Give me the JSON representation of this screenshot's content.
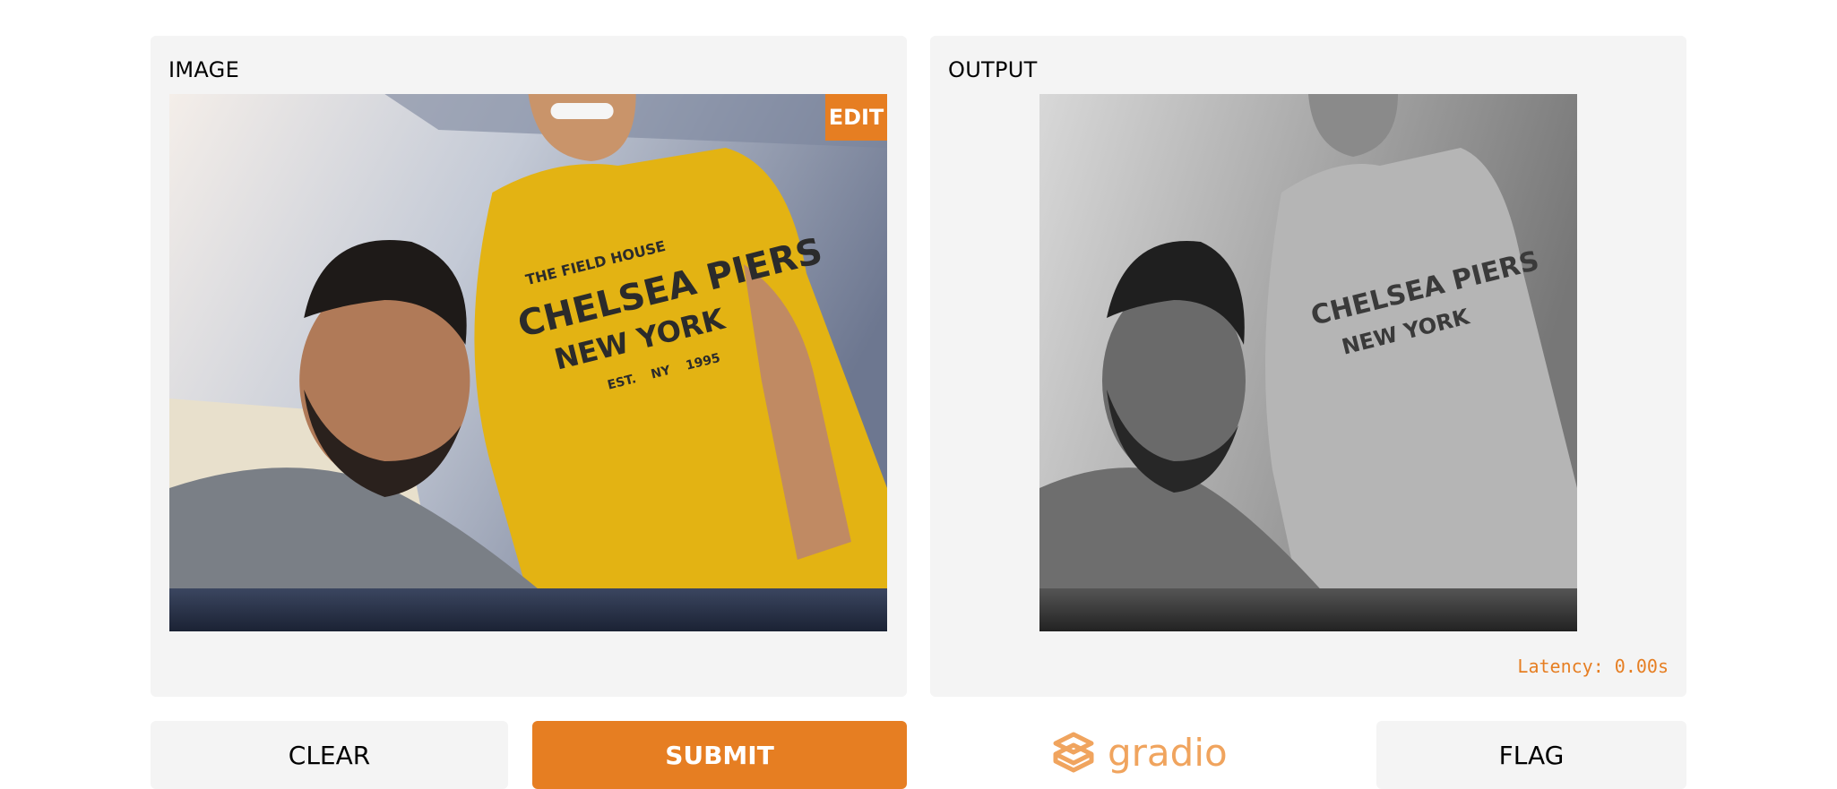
{
  "input_panel": {
    "label": "IMAGE",
    "edit_label": "EDIT",
    "image": {
      "description_icon": "webcam-photo",
      "shirt_line_1": "THE FIELD HOUSE",
      "shirt_line_2": "CHELSEA PIERS",
      "shirt_line_3": "NEW YORK",
      "shirt_line_4_left": "EST.",
      "shirt_line_4_mid": "NY",
      "shirt_line_4_right": "1995"
    }
  },
  "output_panel": {
    "label": "OUTPUT",
    "latency": "Latency: 0.00s"
  },
  "buttons": {
    "clear": "CLEAR",
    "submit": "SUBMIT",
    "flag": "FLAG"
  },
  "branding": {
    "name": "gradio",
    "logo_icon": "gradio-logo-icon"
  },
  "colors": {
    "accent": "#e67e22",
    "panel": "#f4f4f4",
    "logo": "#f0a45e"
  }
}
